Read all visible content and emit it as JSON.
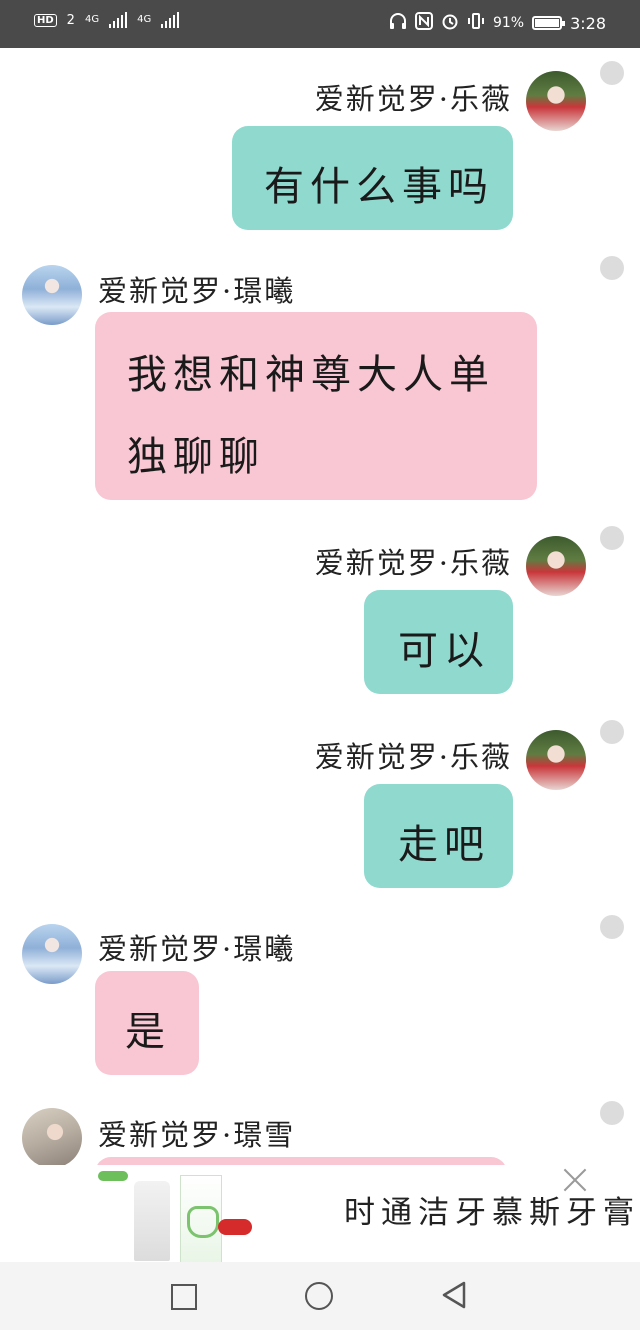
{
  "status_bar": {
    "hd_label": "HD",
    "sim1": "2",
    "sim1_network": "4G",
    "sim2_network": "4G",
    "battery_percent_label": "91%",
    "battery_level": 0.91,
    "time": "3:28"
  },
  "messages": [
    {
      "sender": "爱新觉罗·乐薇",
      "text": "有什么事吗",
      "side": "right",
      "color": "#8fd9cf"
    },
    {
      "sender": "爱新觉罗·璟曦",
      "text": "我想和神尊大人单",
      "text2": "独聊聊",
      "side": "left",
      "color": "#f9c7d3"
    },
    {
      "sender": "爱新觉罗·乐薇",
      "text": "可以",
      "side": "right",
      "color": "#8fd9cf"
    },
    {
      "sender": "爱新觉罗·乐薇",
      "text": "走吧",
      "side": "right",
      "color": "#8fd9cf"
    },
    {
      "sender": "爱新觉罗·璟曦",
      "text": "是",
      "side": "left",
      "color": "#f9c7d3"
    },
    {
      "sender": "爱新觉罗·璟雪",
      "text": "",
      "side": "left",
      "color": "#f9c7d3"
    }
  ],
  "ad": {
    "title": "时通洁牙慕斯牙膏",
    "close_icon": "close-icon"
  },
  "nav": {
    "back_icon": "back-triangle-icon",
    "home_icon": "home-circle-icon",
    "recent_icon": "recent-square-icon"
  }
}
